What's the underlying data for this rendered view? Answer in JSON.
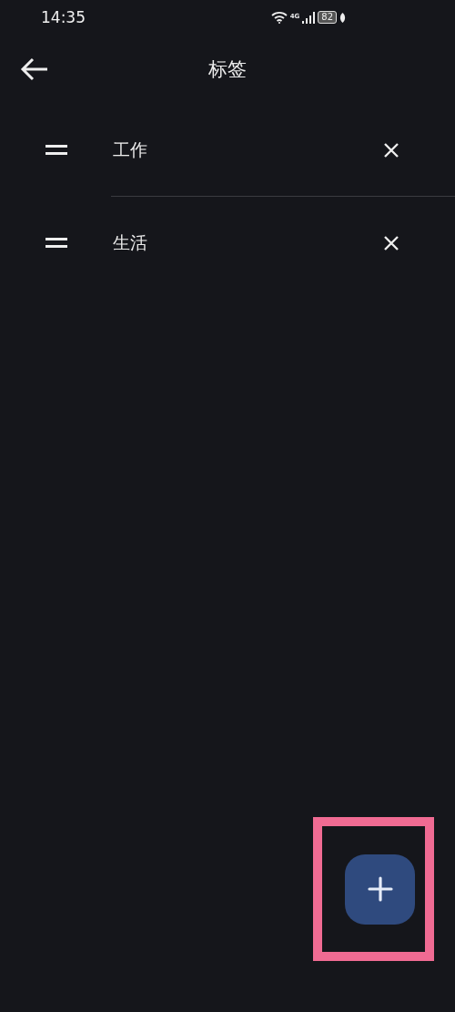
{
  "status_bar": {
    "time": "14:35",
    "network": "4G",
    "battery": "82"
  },
  "app_bar": {
    "title": "标签"
  },
  "tags": [
    {
      "label": "工作",
      "divider": true
    },
    {
      "label": "生活",
      "divider": false
    }
  ],
  "fab": {
    "highlighted": true
  }
}
